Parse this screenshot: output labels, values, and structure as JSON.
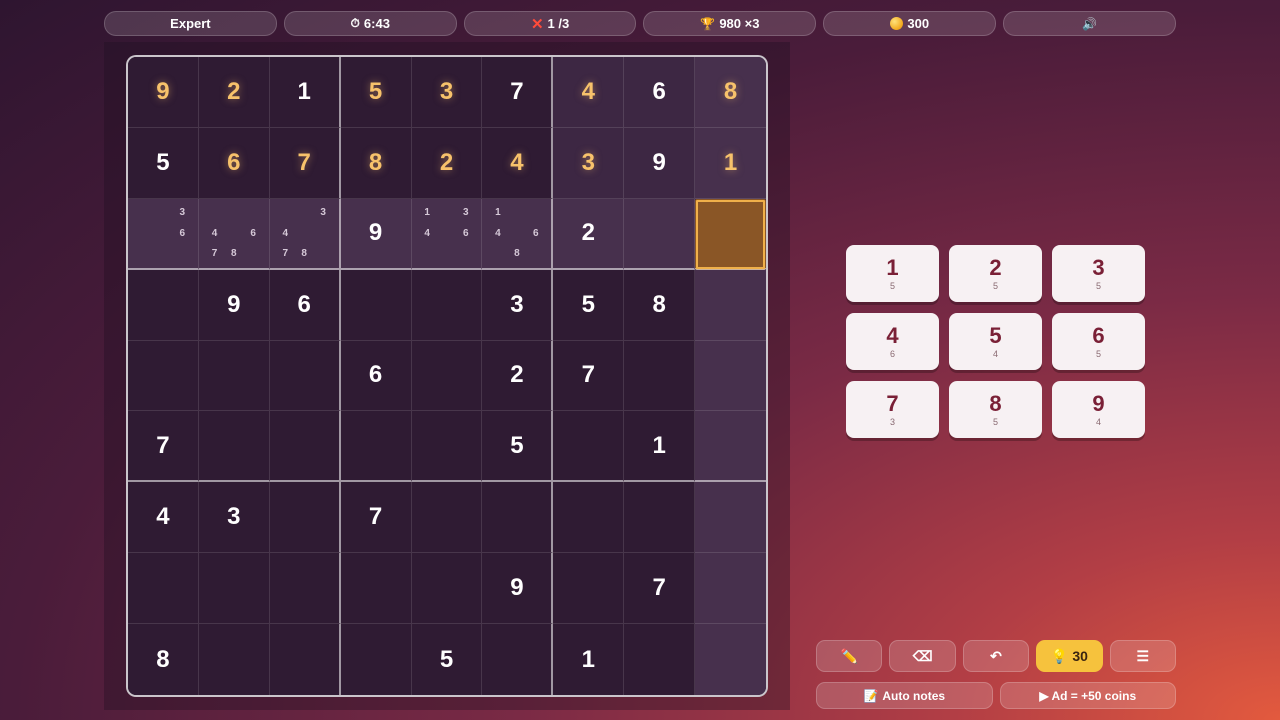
{
  "topbar": {
    "difficulty": "Expert",
    "timer": "6:43",
    "mistakes": "1 /3",
    "score": "980 ×3",
    "coins": "300"
  },
  "grid": [
    [
      {
        "v": "9",
        "g": true
      },
      {
        "v": "2",
        "g": true
      },
      {
        "v": "1"
      },
      {
        "v": "5",
        "g": true
      },
      {
        "v": "3",
        "g": true
      },
      {
        "v": "7"
      },
      {
        "v": "4",
        "g": true
      },
      {
        "v": "6"
      },
      {
        "v": "8",
        "g": true
      }
    ],
    [
      {
        "v": "5"
      },
      {
        "v": "6",
        "g": true
      },
      {
        "v": "7",
        "g": true
      },
      {
        "v": "8",
        "g": true
      },
      {
        "v": "2",
        "g": true
      },
      {
        "v": "4",
        "g": true
      },
      {
        "v": "3",
        "g": true
      },
      {
        "v": "9"
      },
      {
        "v": "1",
        "g": true
      }
    ],
    [
      {
        "n": [
          "",
          "",
          "3",
          "",
          "",
          "6",
          "",
          "",
          ""
        ]
      },
      {
        "n": [
          "",
          "",
          "",
          "4",
          "",
          "6",
          "7",
          "8",
          ""
        ]
      },
      {
        "n": [
          "",
          "",
          "3",
          "4",
          "",
          "",
          "7",
          "8",
          ""
        ]
      },
      {
        "v": "9"
      },
      {
        "n": [
          "1",
          "",
          "3",
          "4",
          "",
          "6",
          "",
          "",
          ""
        ]
      },
      {
        "n": [
          "1",
          "",
          "",
          "4",
          "",
          "6",
          "",
          "8",
          ""
        ]
      },
      {
        "v": "2"
      },
      {
        "v": ""
      },
      {
        "v": "",
        "sel": true
      }
    ],
    [
      {
        "v": ""
      },
      {
        "v": "9"
      },
      {
        "v": "6"
      },
      {
        "v": ""
      },
      {
        "v": ""
      },
      {
        "v": "3"
      },
      {
        "v": "5"
      },
      {
        "v": "8"
      },
      {
        "v": ""
      }
    ],
    [
      {
        "v": ""
      },
      {
        "v": ""
      },
      {
        "v": ""
      },
      {
        "v": "6"
      },
      {
        "v": ""
      },
      {
        "v": "2"
      },
      {
        "v": "7"
      },
      {
        "v": ""
      },
      {
        "v": ""
      }
    ],
    [
      {
        "v": "7"
      },
      {
        "v": ""
      },
      {
        "v": ""
      },
      {
        "v": ""
      },
      {
        "v": ""
      },
      {
        "v": "5"
      },
      {
        "v": ""
      },
      {
        "v": "1"
      },
      {
        "v": ""
      }
    ],
    [
      {
        "v": "4"
      },
      {
        "v": "3"
      },
      {
        "v": ""
      },
      {
        "v": "7"
      },
      {
        "v": ""
      },
      {
        "v": ""
      },
      {
        "v": ""
      },
      {
        "v": ""
      },
      {
        "v": ""
      }
    ],
    [
      {
        "v": ""
      },
      {
        "v": ""
      },
      {
        "v": ""
      },
      {
        "v": ""
      },
      {
        "v": ""
      },
      {
        "v": "9"
      },
      {
        "v": ""
      },
      {
        "v": "7"
      },
      {
        "v": ""
      }
    ],
    [
      {
        "v": "8"
      },
      {
        "v": ""
      },
      {
        "v": ""
      },
      {
        "v": ""
      },
      {
        "v": "5"
      },
      {
        "v": ""
      },
      {
        "v": "1"
      },
      {
        "v": ""
      },
      {
        "v": ""
      }
    ]
  ],
  "numpad": [
    {
      "num": "1",
      "count": "5"
    },
    {
      "num": "2",
      "count": "5"
    },
    {
      "num": "3",
      "count": "5"
    },
    {
      "num": "4",
      "count": "6"
    },
    {
      "num": "5",
      "count": "4"
    },
    {
      "num": "6",
      "count": "5"
    },
    {
      "num": "7",
      "count": "3"
    },
    {
      "num": "8",
      "count": "5"
    },
    {
      "num": "9",
      "count": "4"
    }
  ],
  "toolbar": {
    "pencil_icon": "✏️",
    "erase_icon": "⌫",
    "undo_icon": "↶",
    "hint_count": "30",
    "menu_icon": "☰"
  },
  "bottom": {
    "auto_notes": "Auto notes",
    "ad": "▶ Ad = +50 coins"
  },
  "colors": {
    "gold": "#f7c26b",
    "selected": "#8a5626",
    "hint": "#f6c23d"
  }
}
